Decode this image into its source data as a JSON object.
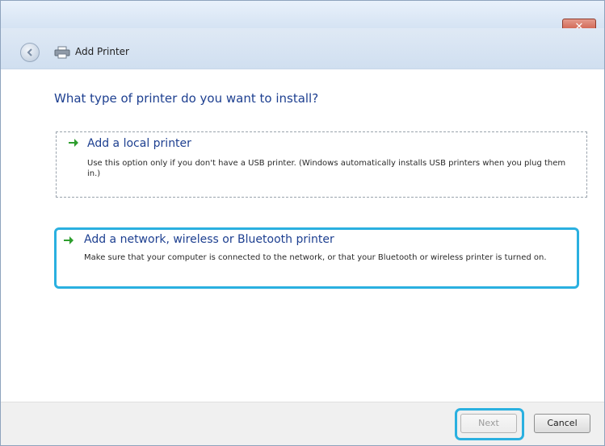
{
  "window": {
    "title": "Add Printer",
    "close_label": "✕"
  },
  "heading": "What type of printer do you want to install?",
  "options": [
    {
      "title": "Add a local printer",
      "description": "Use this option only if you don't have a USB printer. (Windows automatically installs USB printers when you plug them in.)"
    },
    {
      "title": "Add a network, wireless or Bluetooth printer",
      "description": "Make sure that your computer is connected to the network, or that your Bluetooth or wireless printer is turned on.",
      "highlighted": true
    }
  ],
  "footer": {
    "next_label": "Next",
    "cancel_label": "Cancel"
  },
  "colors": {
    "accent_highlight": "#2ab0e0",
    "heading_blue": "#1d3f90",
    "arrow_green": "#2e9e2e"
  }
}
